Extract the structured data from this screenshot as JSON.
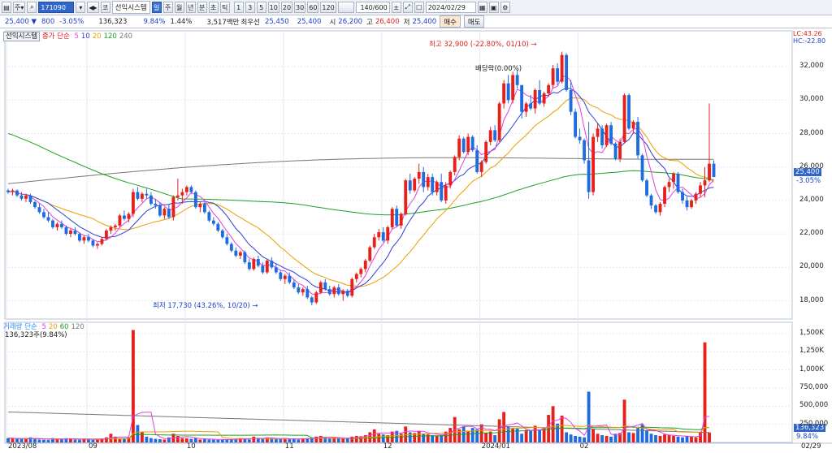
{
  "toolbar": {
    "type_label": "주",
    "code": "171090",
    "market_label": "코",
    "stock_name": "선익시스템",
    "periods": [
      "일",
      "주",
      "월",
      "년",
      "분",
      "초",
      "틱"
    ],
    "active_period": "일",
    "intervals": [
      "1",
      "3",
      "5",
      "10",
      "20",
      "30",
      "60",
      "120"
    ],
    "count": "140/600",
    "date": "2024/02/29"
  },
  "quote": {
    "price": "25,400",
    "change": "800",
    "change_pct": "-3.05%",
    "volume": "136,323",
    "volume_ratio": "9.84%",
    "turnover": "1.44%",
    "amount": "3,517백만",
    "best_ask_label": "최우선",
    "best_ask": "25,450",
    "best_bid": "25,400",
    "open_label": "시",
    "open": "26,200",
    "high_label": "고",
    "high": "26,400",
    "low_label": "저",
    "low": "25,400",
    "buy_label": "매수",
    "sell_label": "매도"
  },
  "price_panel": {
    "name_tag": "선익시스템",
    "legend_title": "종가 단순",
    "ma_periods": [
      "5",
      "10",
      "20",
      "120",
      "240"
    ],
    "ma_colors": [
      "#e040e0",
      "#2d3fd8",
      "#e8a000",
      "#1f9f1f",
      "#777777"
    ],
    "lc_label": "LC:43.26",
    "hc_label": "HC:-22.80",
    "y_ticks": [
      "32,000",
      "30,000",
      "28,000",
      "26,000",
      "24,000",
      "22,000",
      "20,000",
      "18,000"
    ],
    "current_price": "25,400",
    "current_pct": "-3.05%",
    "high_annotation": "최고 32,900 (-22.80%, 01/10)",
    "low_annotation": "최저 17,730 (43.26%, 10/20)",
    "ex_dividend": "배당락(0.00%)"
  },
  "volume_panel": {
    "legend_title": "거래량 단순",
    "ma_periods": [
      "5",
      "20",
      "60",
      "120"
    ],
    "current": "136,323주(9.84%)",
    "y_ticks": [
      "1,500K",
      "1,250K",
      "1,000K",
      "750,000",
      "500,000",
      "250,000"
    ],
    "current_tag": "136,323",
    "current_pct": "9.84%"
  },
  "x_axis": {
    "labels": [
      "2023/08",
      "09",
      "10",
      "11",
      "12",
      "2024/01",
      "02"
    ],
    "end_label": "02/29"
  },
  "chart_data": {
    "type": "candlestick",
    "title": "선익시스템",
    "period": "daily",
    "price_range": [
      17000,
      33000
    ],
    "high": {
      "value": 32900,
      "date": "01/10"
    },
    "low": {
      "value": 17730,
      "date": "10/20"
    },
    "candles": [
      [
        24600,
        24700,
        24400,
        24500
      ],
      [
        24500,
        24700,
        24300,
        24600
      ],
      [
        24600,
        24650,
        24200,
        24300
      ],
      [
        24300,
        24500,
        24000,
        24100
      ],
      [
        24100,
        24400,
        23900,
        24300
      ],
      [
        24300,
        24400,
        23800,
        23900
      ],
      [
        23900,
        24000,
        23500,
        23600
      ],
      [
        23600,
        23800,
        23200,
        23300
      ],
      [
        23300,
        23500,
        22900,
        23000
      ],
      [
        23000,
        23300,
        22700,
        22800
      ],
      [
        22800,
        22900,
        22300,
        22400
      ],
      [
        22400,
        22700,
        22200,
        22600
      ],
      [
        22600,
        22800,
        22300,
        22400
      ],
      [
        22400,
        22500,
        21900,
        22000
      ],
      [
        22000,
        22300,
        21800,
        22200
      ],
      [
        22200,
        22400,
        21900,
        22000
      ],
      [
        22000,
        22100,
        21500,
        21600
      ],
      [
        21600,
        21900,
        21400,
        21800
      ],
      [
        21800,
        22000,
        21500,
        21600
      ],
      [
        21600,
        21700,
        21200,
        21300
      ],
      [
        21300,
        21500,
        21100,
        21400
      ],
      [
        21400,
        21800,
        21300,
        21700
      ],
      [
        21700,
        22300,
        21600,
        22200
      ],
      [
        22200,
        22500,
        22000,
        22400
      ],
      [
        22400,
        22600,
        22200,
        22500
      ],
      [
        22500,
        23200,
        22400,
        23100
      ],
      [
        23100,
        23400,
        22800,
        22900
      ],
      [
        22900,
        23300,
        22700,
        23200
      ],
      [
        23200,
        24700,
        23000,
        24500
      ],
      [
        24500,
        24800,
        24000,
        24100
      ],
      [
        24100,
        24500,
        23900,
        24400
      ],
      [
        24400,
        24700,
        24100,
        24300
      ],
      [
        24300,
        24500,
        23700,
        23800
      ],
      [
        23800,
        24100,
        23500,
        23700
      ],
      [
        23700,
        23900,
        23000,
        23100
      ],
      [
        23100,
        23600,
        22900,
        23500
      ],
      [
        23500,
        23800,
        22900,
        23000
      ],
      [
        23000,
        24300,
        22800,
        24200
      ],
      [
        24200,
        25300,
        24000,
        24300
      ],
      [
        24300,
        24700,
        23800,
        24500
      ],
      [
        24500,
        24900,
        24300,
        24800
      ],
      [
        24800,
        24900,
        24400,
        24500
      ],
      [
        24500,
        24600,
        23500,
        23600
      ],
      [
        23600,
        23900,
        23300,
        23800
      ],
      [
        23800,
        23900,
        23200,
        23300
      ],
      [
        23300,
        23400,
        22700,
        22800
      ],
      [
        22800,
        23000,
        22500,
        22600
      ],
      [
        22600,
        22700,
        22100,
        22200
      ],
      [
        22200,
        22300,
        21700,
        21800
      ],
      [
        21800,
        22000,
        21300,
        21400
      ],
      [
        21400,
        21500,
        20900,
        21000
      ],
      [
        21000,
        21200,
        20600,
        20700
      ],
      [
        20700,
        21000,
        20500,
        20900
      ],
      [
        20900,
        21000,
        20200,
        20300
      ],
      [
        20300,
        20500,
        19800,
        19900
      ],
      [
        19900,
        20600,
        19800,
        20500
      ],
      [
        20500,
        20700,
        20000,
        20100
      ],
      [
        20100,
        20300,
        19600,
        19700
      ],
      [
        19700,
        20500,
        19600,
        20400
      ],
      [
        20400,
        20600,
        19900,
        20000
      ],
      [
        20000,
        20200,
        19600,
        19700
      ],
      [
        19700,
        19800,
        19200,
        19300
      ],
      [
        19300,
        19600,
        19000,
        19500
      ],
      [
        19500,
        19700,
        19000,
        19100
      ],
      [
        19100,
        19300,
        18700,
        18800
      ],
      [
        18800,
        19000,
        18400,
        18500
      ],
      [
        18500,
        18800,
        18300,
        18700
      ],
      [
        18700,
        18900,
        18100,
        18200
      ],
      [
        18200,
        18300,
        17730,
        17900
      ],
      [
        17900,
        18600,
        17800,
        18500
      ],
      [
        18500,
        19200,
        18400,
        19100
      ],
      [
        19100,
        19300,
        18600,
        18700
      ],
      [
        18700,
        18900,
        18300,
        18400
      ],
      [
        18400,
        18900,
        18200,
        18800
      ],
      [
        18800,
        19000,
        18300,
        18400
      ],
      [
        18400,
        18700,
        18000,
        18600
      ],
      [
        18600,
        18700,
        18200,
        18300
      ],
      [
        18300,
        19400,
        18200,
        19300
      ],
      [
        19300,
        19700,
        19100,
        19600
      ],
      [
        19600,
        20000,
        19400,
        19900
      ],
      [
        19900,
        20500,
        19700,
        20400
      ],
      [
        20400,
        21300,
        20300,
        21200
      ],
      [
        21200,
        22000,
        21100,
        21800
      ],
      [
        21800,
        22300,
        21600,
        22100
      ],
      [
        22100,
        22400,
        21500,
        21600
      ],
      [
        21600,
        22500,
        21400,
        22400
      ],
      [
        22400,
        23600,
        22300,
        23500
      ],
      [
        23500,
        23700,
        22400,
        22500
      ],
      [
        22500,
        23300,
        22300,
        23200
      ],
      [
        23200,
        25300,
        23100,
        25200
      ],
      [
        25200,
        25600,
        24400,
        24600
      ],
      [
        24600,
        25400,
        24500,
        25300
      ],
      [
        25300,
        26200,
        25000,
        25700
      ],
      [
        25700,
        26000,
        24500,
        24800
      ],
      [
        24800,
        25600,
        24600,
        25400
      ],
      [
        25400,
        25600,
        24300,
        24500
      ],
      [
        24500,
        25200,
        24300,
        25100
      ],
      [
        25100,
        25600,
        23900,
        24000
      ],
      [
        24000,
        25100,
        23800,
        24900
      ],
      [
        24900,
        25800,
        24700,
        25700
      ],
      [
        25700,
        26700,
        25500,
        26600
      ],
      [
        26600,
        27900,
        26400,
        27700
      ],
      [
        27700,
        27800,
        26800,
        26900
      ],
      [
        26900,
        28000,
        26700,
        27800
      ],
      [
        27800,
        27900,
        26900,
        27000
      ],
      [
        27000,
        27300,
        25600,
        25700
      ],
      [
        25700,
        26400,
        25400,
        26300
      ],
      [
        26300,
        27600,
        26200,
        27500
      ],
      [
        27500,
        28400,
        27300,
        28200
      ],
      [
        28200,
        28500,
        27500,
        27600
      ],
      [
        27600,
        29900,
        27500,
        29800
      ],
      [
        29800,
        31200,
        29500,
        31000
      ],
      [
        31000,
        31500,
        29800,
        30000
      ],
      [
        30000,
        31700,
        29800,
        31500
      ],
      [
        31500,
        31800,
        30700,
        30900
      ],
      [
        30900,
        30100,
        28900,
        29300
      ],
      [
        29300,
        29900,
        29000,
        29800
      ],
      [
        29800,
        30300,
        29400,
        29500
      ],
      [
        29500,
        30700,
        29200,
        30600
      ],
      [
        30600,
        31200,
        29700,
        29800
      ],
      [
        29800,
        30500,
        29600,
        30400
      ],
      [
        30400,
        31000,
        30200,
        30900
      ],
      [
        30900,
        32100,
        30700,
        31900
      ],
      [
        31900,
        32200,
        30900,
        31100
      ],
      [
        31100,
        32900,
        31000,
        32700
      ],
      [
        32700,
        32800,
        30500,
        30600
      ],
      [
        30600,
        31200,
        29100,
        29300
      ],
      [
        29300,
        29500,
        27700,
        27800
      ],
      [
        27800,
        28300,
        27400,
        27600
      ],
      [
        27600,
        27700,
        26200,
        26400
      ],
      [
        26400,
        28700,
        24100,
        24500
      ],
      [
        24500,
        28000,
        24300,
        27800
      ],
      [
        27800,
        28600,
        27500,
        28300
      ],
      [
        28300,
        28500,
        27100,
        27300
      ],
      [
        27300,
        28600,
        27200,
        28500
      ],
      [
        28500,
        28700,
        27300,
        27400
      ],
      [
        27400,
        27500,
        26400,
        26500
      ],
      [
        26500,
        27700,
        26300,
        27500
      ],
      [
        27500,
        30400,
        27400,
        30300
      ],
      [
        30300,
        30400,
        28200,
        28300
      ],
      [
        28300,
        28800,
        28000,
        28700
      ],
      [
        28700,
        29000,
        26500,
        26700
      ],
      [
        26700,
        26800,
        25100,
        25200
      ],
      [
        25200,
        25300,
        24200,
        24300
      ],
      [
        24300,
        24400,
        23500,
        23700
      ],
      [
        23700,
        23800,
        23200,
        23300
      ],
      [
        23300,
        23900,
        23100,
        23800
      ],
      [
        23800,
        24900,
        23600,
        24800
      ],
      [
        24800,
        25300,
        24500,
        25100
      ],
      [
        25100,
        25700,
        24700,
        25600
      ],
      [
        25600,
        25700,
        24400,
        24500
      ],
      [
        24500,
        24700,
        23800,
        24000
      ],
      [
        24000,
        24200,
        23400,
        23600
      ],
      [
        23600,
        24100,
        23500,
        24000
      ],
      [
        24000,
        24500,
        23800,
        24400
      ],
      [
        24400,
        25100,
        24200,
        24900
      ],
      [
        24900,
        26000,
        24200,
        25200
      ],
      [
        25200,
        29800,
        25100,
        26200
      ],
      [
        26200,
        26400,
        25400,
        25400
      ]
    ],
    "volume_max": 1500000,
    "volume": [
      60000,
      55000,
      50000,
      48000,
      45000,
      70000,
      52000,
      40000,
      38000,
      35000,
      60000,
      50000,
      42000,
      58000,
      46000,
      40000,
      36000,
      50000,
      44000,
      34000,
      38000,
      56000,
      70000,
      120000,
      80000,
      45000,
      60000,
      70000,
      1550000,
      240000,
      150000,
      80000,
      60000,
      50000,
      45000,
      40000,
      70000,
      120000,
      90000,
      60000,
      55000,
      50000,
      60000,
      40000,
      45000,
      40000,
      38000,
      36000,
      40000,
      42000,
      44000,
      46000,
      60000,
      50000,
      40000,
      80000,
      60000,
      50000,
      70000,
      55000,
      50000,
      45000,
      60000,
      50000,
      45000,
      40000,
      55000,
      60000,
      70000,
      80000,
      90000,
      70000,
      60000,
      65000,
      55000,
      50000,
      60000,
      80000,
      90000,
      85000,
      100000,
      140000,
      180000,
      120000,
      110000,
      100000,
      150000,
      160000,
      120000,
      220000,
      140000,
      130000,
      160000,
      120000,
      110000,
      100000,
      90000,
      100000,
      150000,
      200000,
      350000,
      180000,
      220000,
      160000,
      200000,
      180000,
      250000,
      130000,
      150000,
      100000,
      320000,
      420000,
      220000,
      200000,
      190000,
      120000,
      170000,
      160000,
      230000,
      180000,
      200000,
      380000,
      500000,
      260000,
      370000,
      140000,
      110000,
      90000,
      80000,
      70000,
      700000,
      180000,
      120000,
      100000,
      90000,
      80000,
      120000,
      130000,
      590000,
      140000,
      130000,
      200000,
      250000,
      160000,
      120000,
      100000,
      90000,
      110000,
      100000,
      90000,
      80000,
      70000,
      90000,
      80000,
      70000,
      140000,
      1380000,
      136323
    ]
  }
}
